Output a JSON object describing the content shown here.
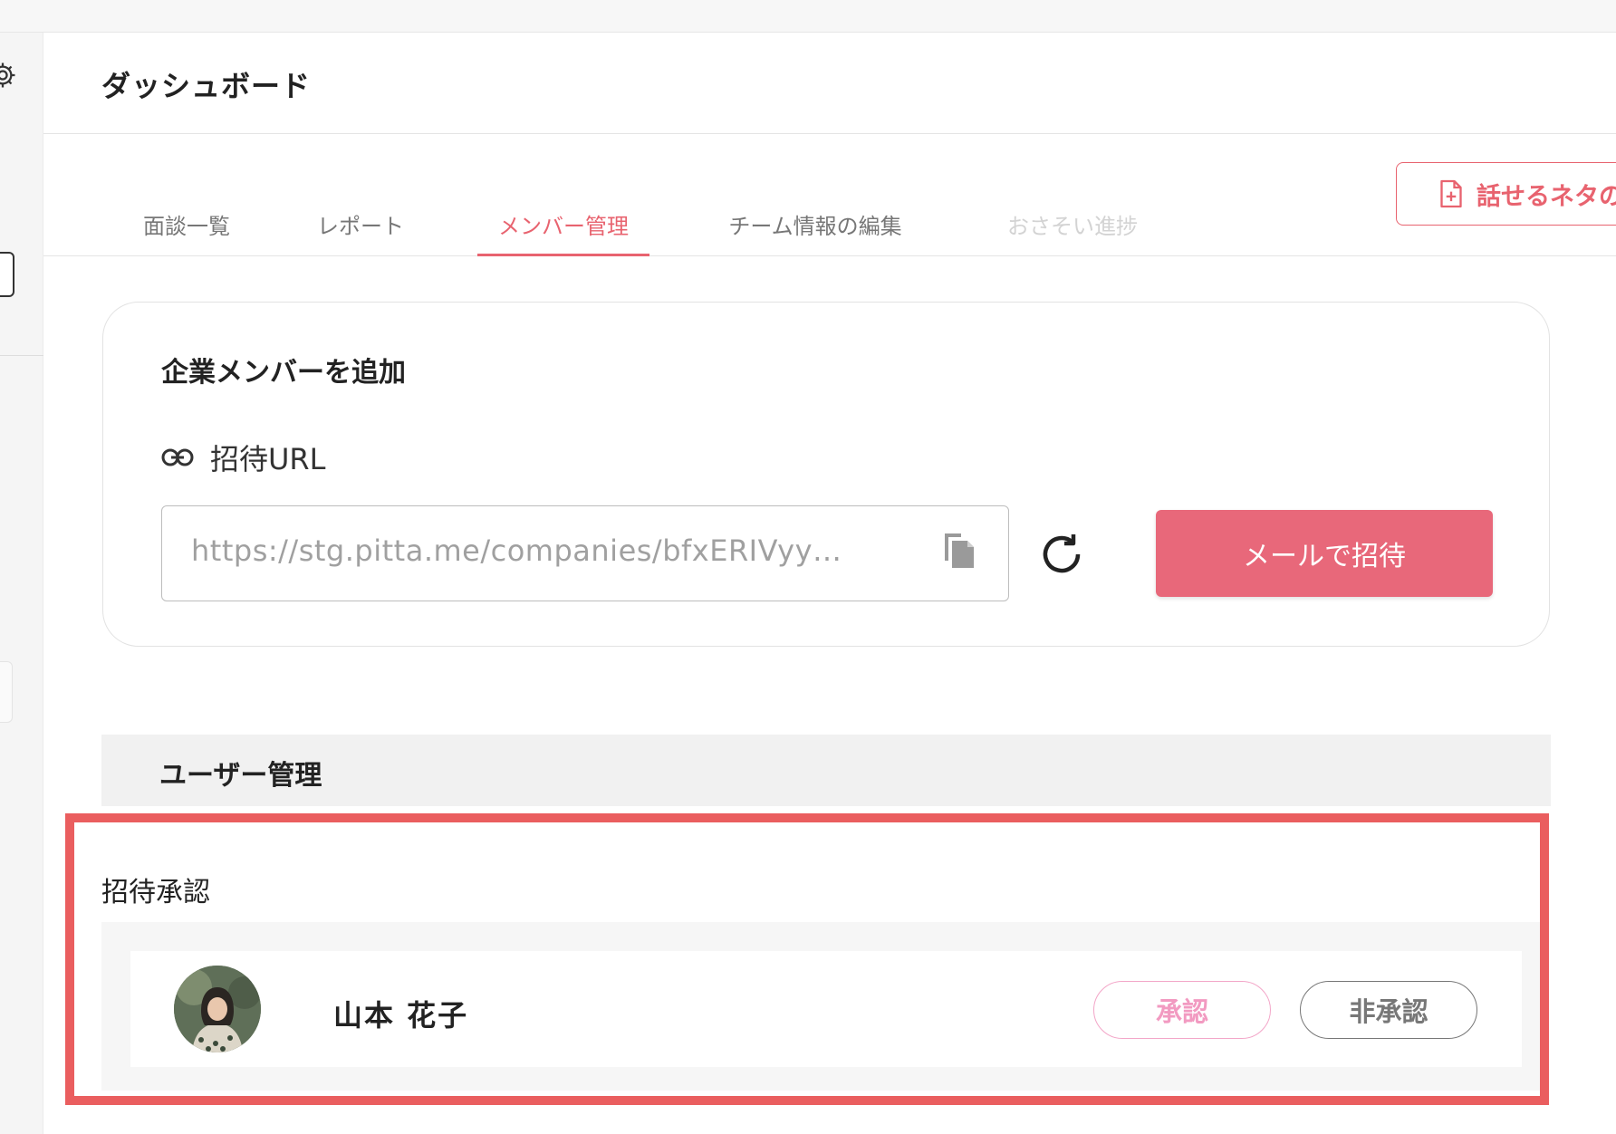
{
  "header": {
    "title": "ダッシュボード"
  },
  "tabs": [
    {
      "label": "面談一覧",
      "state": "normal"
    },
    {
      "label": "レポート",
      "state": "normal"
    },
    {
      "label": "メンバー管理",
      "state": "active"
    },
    {
      "label": "チーム情報の編集",
      "state": "normal"
    },
    {
      "label": "おさそい進捗",
      "state": "disabled"
    }
  ],
  "topic_button": {
    "label": "話せるネタの",
    "icon": "file-plus-icon"
  },
  "add_member": {
    "title": "企業メンバーを追加",
    "url_label": "招待URL",
    "url_value": "https://stg.pitta.me/companies/bfxERIVyy…",
    "invite_button": "メールで招待"
  },
  "user_management": {
    "title": "ユーザー管理",
    "approval_label": "招待承認",
    "requests": [
      {
        "name": "山本 花子",
        "approve_label": "承認",
        "reject_label": "非承認"
      }
    ]
  },
  "colors": {
    "accent": "#e8636f",
    "invite_button_bg": "#e8687a",
    "approve_pink": "#f29ac1",
    "highlight_border": "#ea5e5f"
  }
}
